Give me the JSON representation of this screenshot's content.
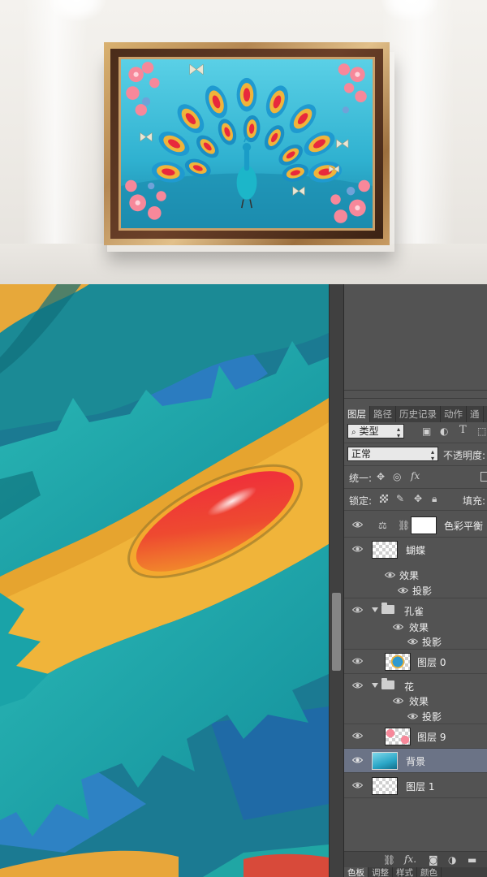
{
  "mockup": {
    "description_note": ""
  },
  "panel": {
    "tabs": [
      {
        "label": "图层",
        "active": true
      },
      {
        "label": "路径",
        "active": false
      },
      {
        "label": "历史记录",
        "active": false
      },
      {
        "label": "动作",
        "active": false
      },
      {
        "label": "通",
        "active": false
      }
    ],
    "filter": {
      "value": "类型",
      "icons": [
        "image-filter-icon",
        "adjustment-filter-icon",
        "type-filter-icon",
        "shape-filter-icon"
      ]
    },
    "blend_mode": "正常",
    "opacity_label": "不透明度:",
    "unify_label": "统一:",
    "lock_label": "锁定:",
    "fill_label": "填充:",
    "layers": [
      {
        "name": "色彩平衡",
        "kind": "adjustment",
        "selected": false
      },
      {
        "name": "蝴蝶",
        "kind": "layer",
        "selected": false
      },
      {
        "name": "效果",
        "kind": "effects",
        "selected": false
      },
      {
        "name": "投影",
        "kind": "effect",
        "selected": false
      },
      {
        "name": "孔雀",
        "kind": "group",
        "selected": false
      },
      {
        "name": "效果",
        "kind": "effects",
        "selected": false
      },
      {
        "name": "投影",
        "kind": "effect",
        "selected": false
      },
      {
        "name": "图层 0",
        "kind": "layer",
        "selected": false
      },
      {
        "name": "花",
        "kind": "group",
        "selected": false
      },
      {
        "name": "效果",
        "kind": "effects",
        "selected": false
      },
      {
        "name": "投影",
        "kind": "effect",
        "selected": false
      },
      {
        "name": "图层 9",
        "kind": "layer",
        "selected": false
      },
      {
        "name": "背景",
        "kind": "layer",
        "selected": true
      },
      {
        "name": "图层 1",
        "kind": "layer",
        "selected": false
      }
    ],
    "bottom_tabs": [
      {
        "label": "色板",
        "active": true
      },
      {
        "label": "调整",
        "active": false
      },
      {
        "label": "样式",
        "active": false
      },
      {
        "label": "颜色",
        "active": false
      }
    ],
    "bottom_icons": [
      "link-icon",
      "fx-icon",
      "mask-icon",
      "adjustment-icon",
      "folder-icon"
    ]
  },
  "colors": {
    "panel_bg": "#535353",
    "selected_row": "#6b7386",
    "canvas_teal": "#1b7a92",
    "feather_yellow": "#f0b43a",
    "eye_red": "#e8293c"
  }
}
